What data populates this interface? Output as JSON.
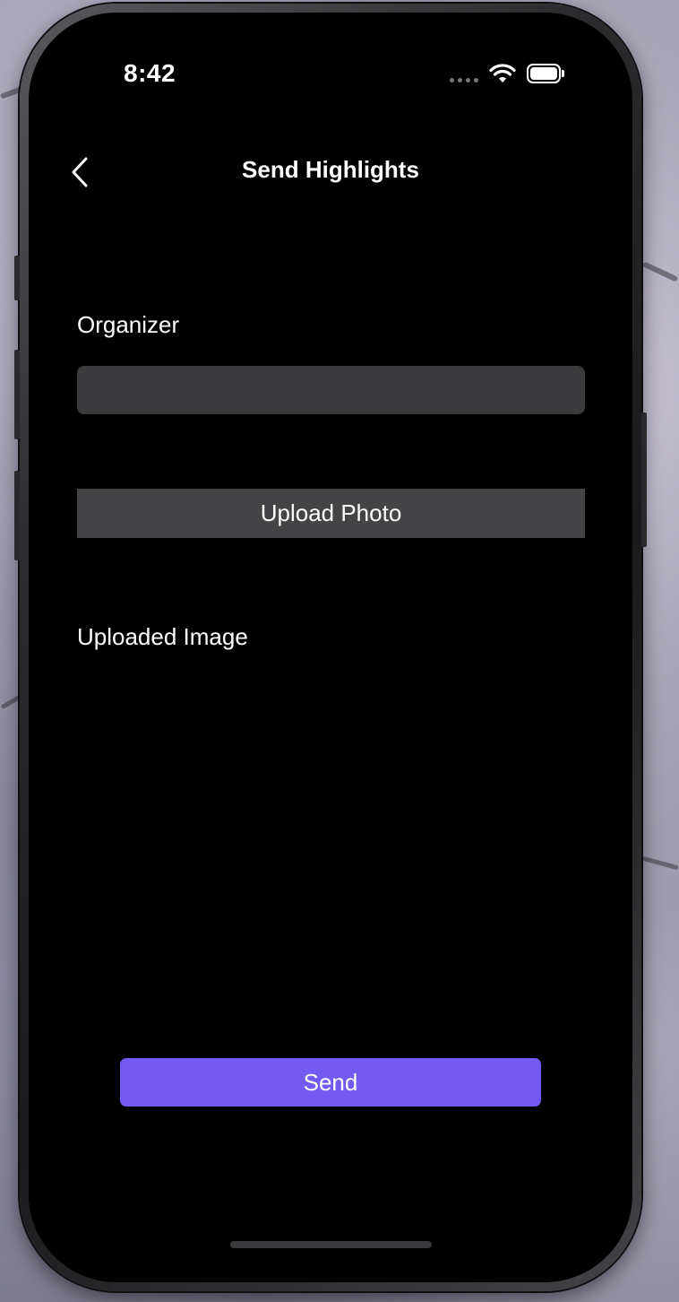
{
  "status_bar": {
    "time": "8:42"
  },
  "nav": {
    "title": "Send Highlights",
    "back_icon": "chevron-left-icon"
  },
  "form": {
    "organizer_label": "Organizer",
    "organizer_value": "",
    "upload_button_label": "Upload Photo",
    "uploaded_image_label": "Uploaded Image",
    "send_button_label": "Send"
  },
  "colors": {
    "accent": "#7459f2",
    "field_background": "#3b3b3d",
    "screen_background": "#000000"
  }
}
